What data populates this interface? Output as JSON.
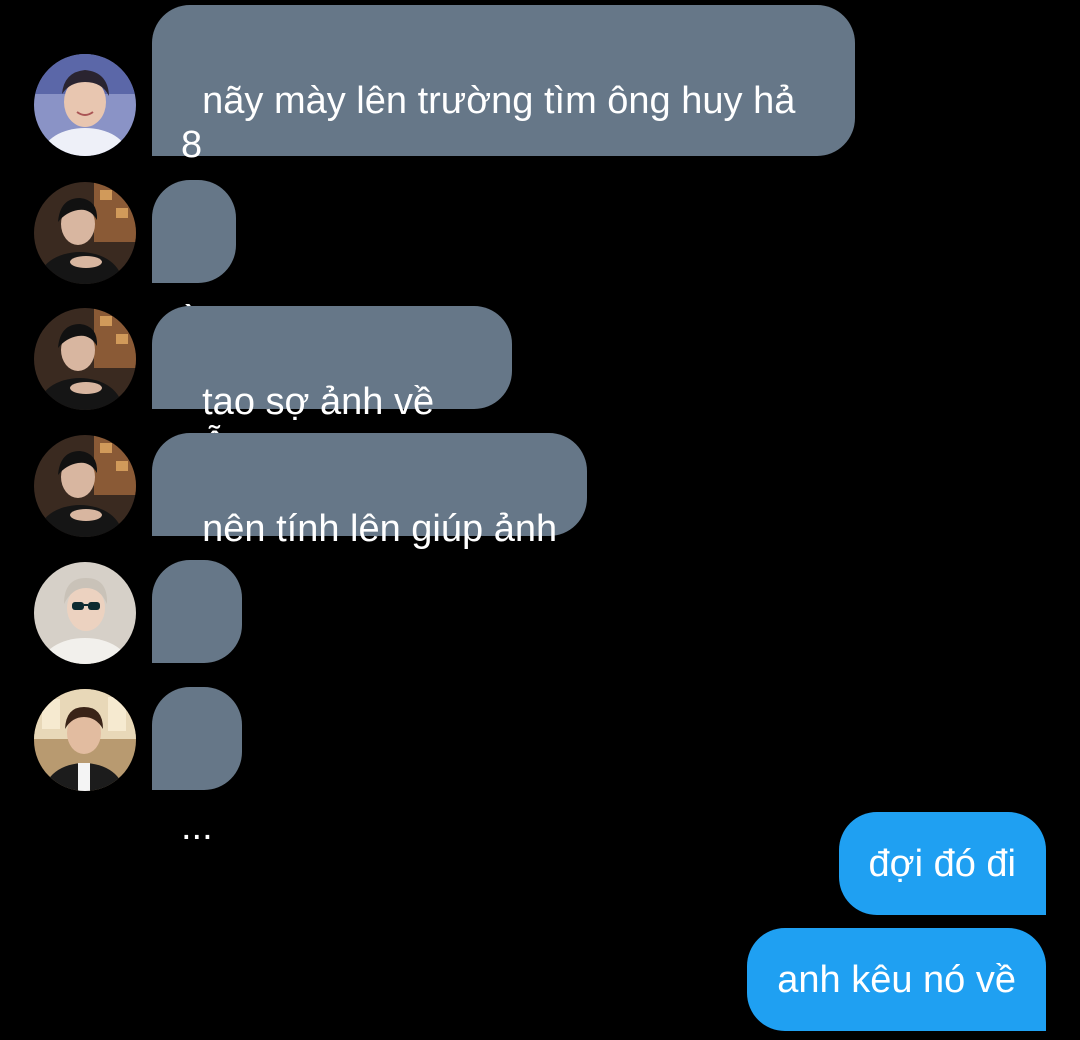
{
  "messages_in": [
    {
      "sender": "avatar-boy-smile",
      "text": "nãy mày lên trường tìm ông huy hả\n8"
    },
    {
      "sender": "avatar-boy-dark",
      "text": "ừ"
    },
    {
      "sender": "avatar-boy-dark",
      "text": "tao sợ ảnh về trễ"
    },
    {
      "sender": "avatar-boy-dark",
      "text": "nên tính lên giúp ảnh"
    },
    {
      "sender": "avatar-boy-sunglasses",
      "text": "..."
    },
    {
      "sender": "avatar-boy-cafe",
      "text": "..."
    }
  ],
  "messages_out": [
    {
      "text": "đợi đó đi"
    },
    {
      "text": "anh kêu nó về"
    }
  ],
  "colors": {
    "background": "#000000",
    "incoming_bubble": "#667788",
    "outgoing_bubble": "#1fa0f2",
    "text": "#ffffff"
  }
}
